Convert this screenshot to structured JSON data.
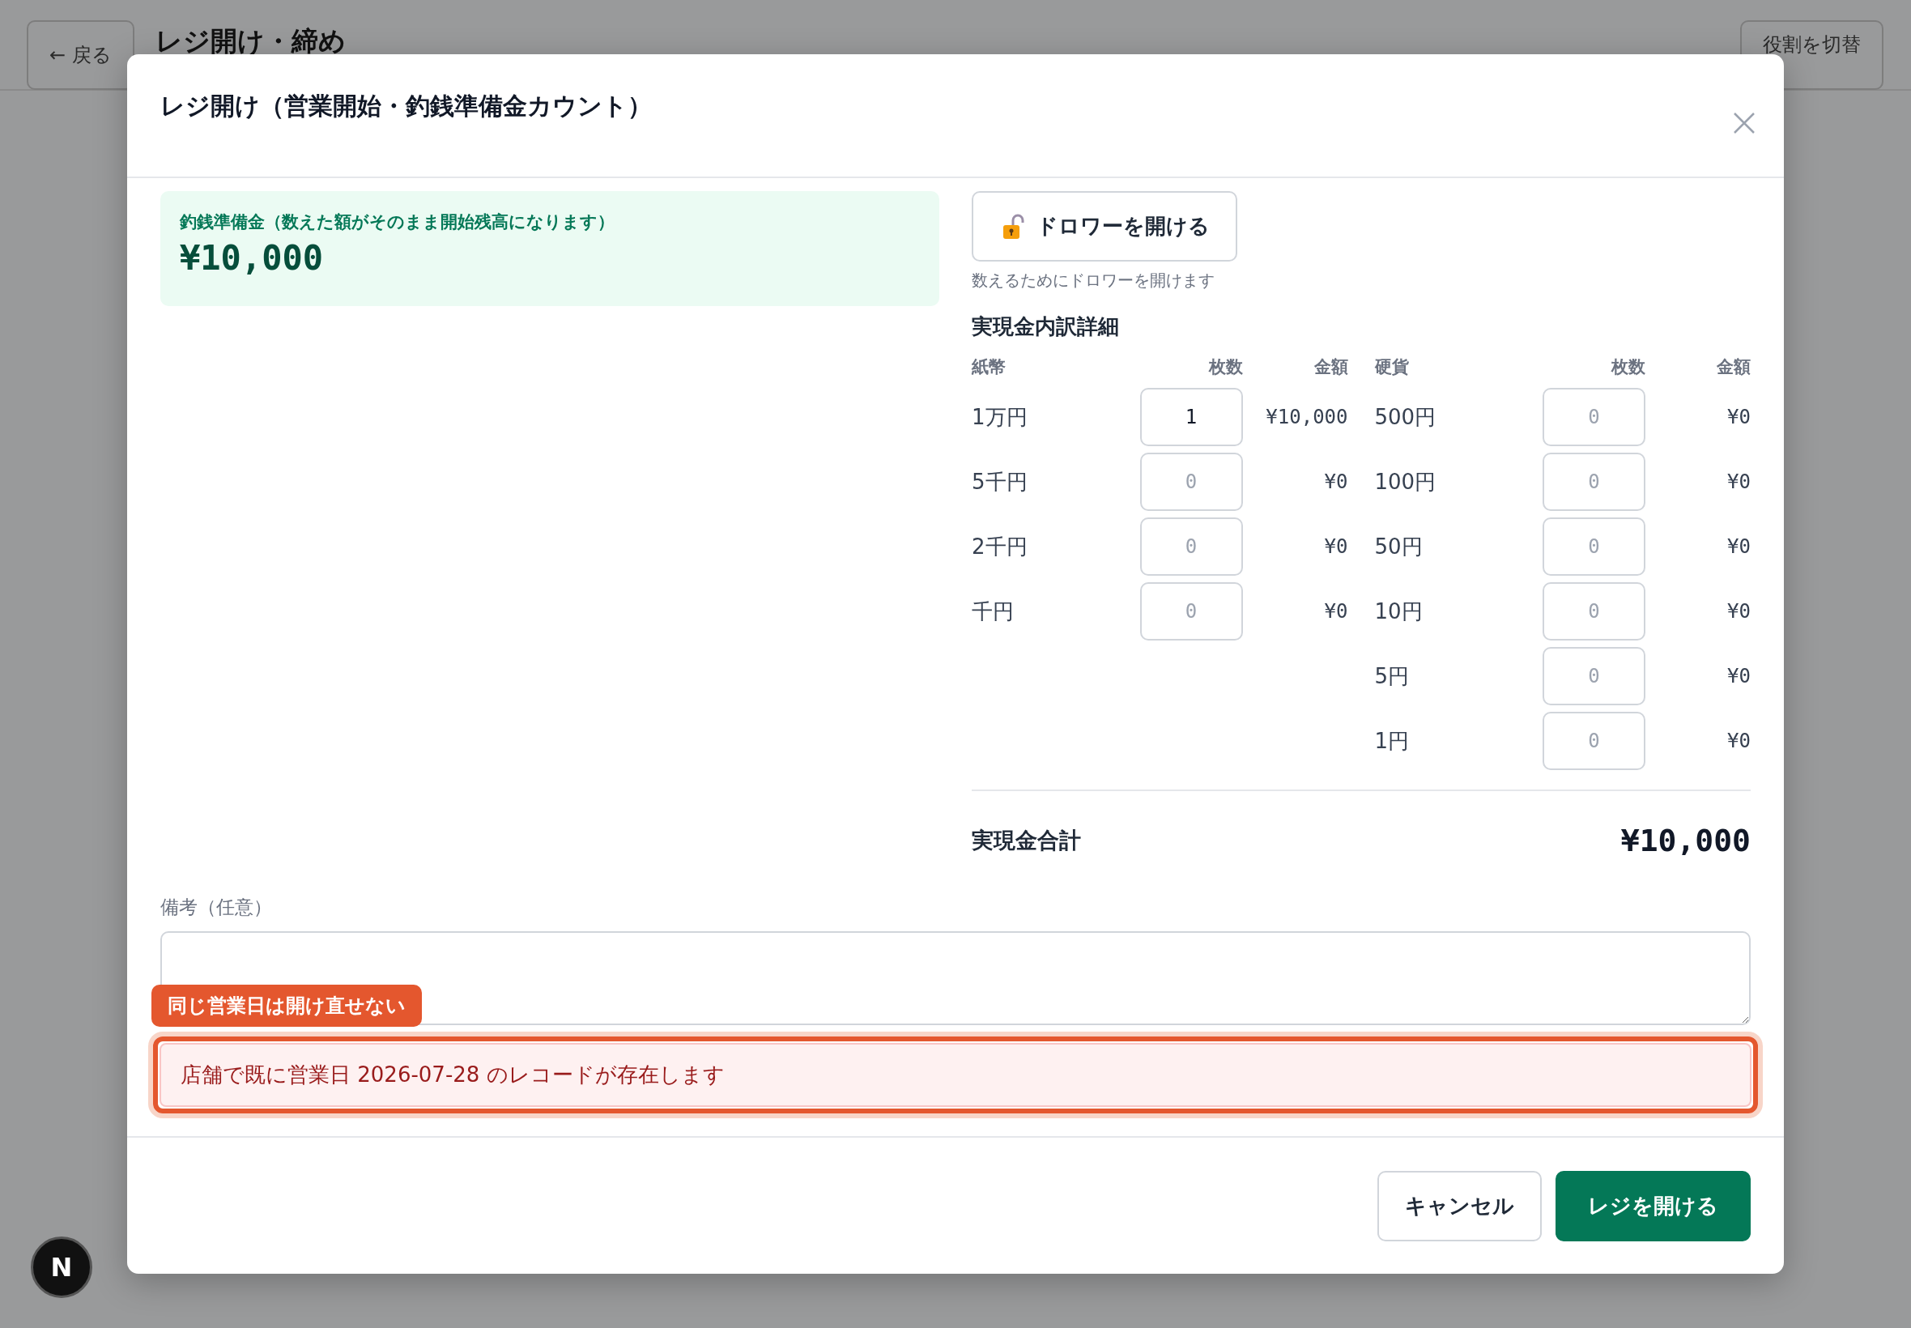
{
  "page": {
    "back_button": "← 戻る",
    "title": "レジ開け・締め",
    "role_button": "役割を切替"
  },
  "dialog": {
    "title": "レジ開け（営業開始・釣銭準備金カウント）",
    "float_summary": {
      "label": "釣銭準備金（数えた額がそのまま開始残高になります）",
      "amount": "¥10,000"
    },
    "drawer_button": "ドロワーを開ける",
    "drawer_hint": "数えるためにドロワーを開けます",
    "breakdown": {
      "title": "実現金内訳詳細",
      "groups": [
        {
          "heading": "紙幣",
          "count_heading": "枚数",
          "amount_heading": "金額",
          "rows": [
            {
              "label": "1万円",
              "value": "1",
              "amount": "¥10,000"
            },
            {
              "label": "5千円",
              "placeholder": "0",
              "amount": "¥0"
            },
            {
              "label": "2千円",
              "placeholder": "0",
              "amount": "¥0"
            },
            {
              "label": "千円",
              "placeholder": "0",
              "amount": "¥0"
            }
          ]
        },
        {
          "heading": "硬貨",
          "count_heading": "枚数",
          "amount_heading": "金額",
          "rows": [
            {
              "label": "500円",
              "placeholder": "0",
              "amount": "¥0"
            },
            {
              "label": "100円",
              "placeholder": "0",
              "amount": "¥0"
            },
            {
              "label": "50円",
              "placeholder": "0",
              "amount": "¥0"
            },
            {
              "label": "10円",
              "placeholder": "0",
              "amount": "¥0"
            },
            {
              "label": "5円",
              "placeholder": "0",
              "amount": "¥0"
            },
            {
              "label": "1円",
              "placeholder": "0",
              "amount": "¥0"
            }
          ]
        }
      ]
    },
    "total": {
      "label": "実現金合計",
      "amount": "¥10,000"
    },
    "notes": {
      "label": "備考（任意）"
    },
    "annotation": "同じ営業日は開け直せない",
    "error": "店舗で既に営業日 2026-07-28 のレコードが存在します",
    "buttons": [
      {
        "label": "キャンセル",
        "kind": "secondary"
      },
      {
        "label": "レジを開ける",
        "kind": "primary"
      }
    ]
  },
  "dev_badge": "N"
}
